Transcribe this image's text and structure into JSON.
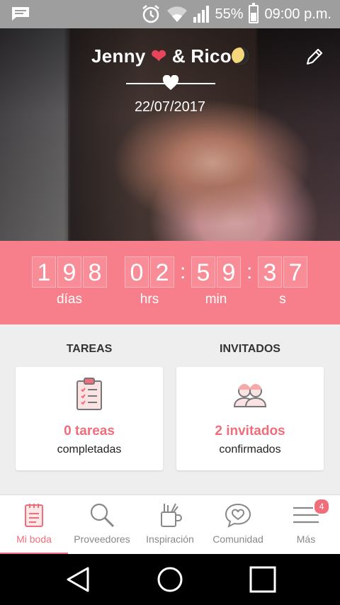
{
  "status_bar": {
    "battery": "55%",
    "time": "09:00 p.m.",
    "battery_level": 0.55
  },
  "hero": {
    "name1": "Jenny",
    "name2": "& Rico",
    "date": "22/07/2017"
  },
  "countdown": {
    "days": [
      "1",
      "9",
      "8"
    ],
    "hours": [
      "0",
      "2"
    ],
    "minutes": [
      "5",
      "9"
    ],
    "seconds": [
      "3",
      "7"
    ],
    "labels": {
      "days": "días",
      "hours": "hrs",
      "minutes": "min",
      "seconds": "s"
    }
  },
  "tasks": {
    "title": "TAREAS",
    "count": "0 tareas",
    "sub": "completadas"
  },
  "guests": {
    "title": "INVITADOS",
    "count": "2 invitados",
    "sub": "confirmados"
  },
  "tabs": [
    {
      "label": "Mi boda",
      "icon": "notebook-icon"
    },
    {
      "label": "Proveedores",
      "icon": "search-icon"
    },
    {
      "label": "Inspiración",
      "icon": "pencil-cup-icon"
    },
    {
      "label": "Comunidad",
      "icon": "chat-heart-icon"
    },
    {
      "label": "Más",
      "icon": "menu-icon",
      "badge": "4"
    }
  ],
  "colors": {
    "accent": "#f06e7b",
    "countdown_bg": "#f77f8b"
  }
}
